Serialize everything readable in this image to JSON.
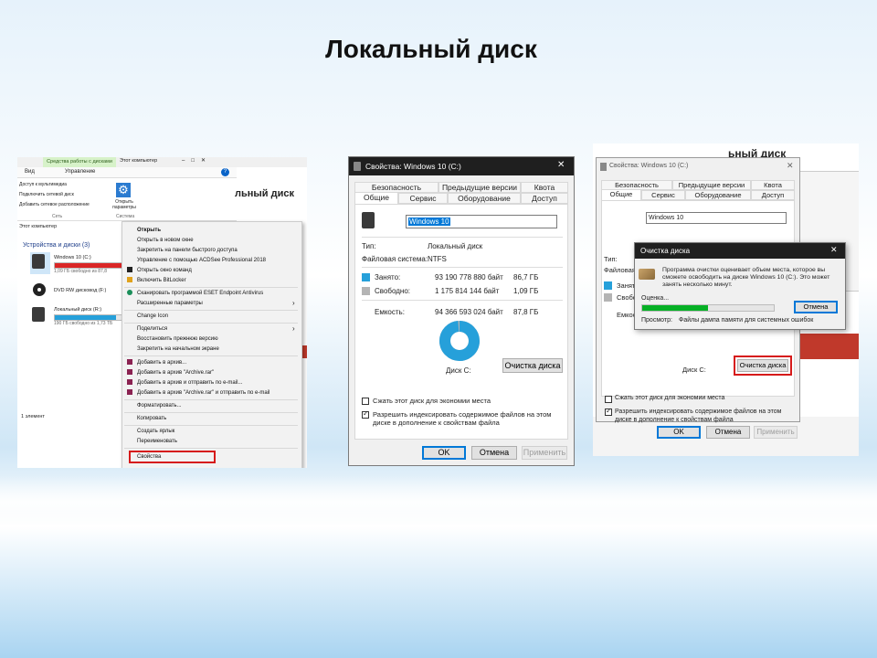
{
  "slide": {
    "title": "Локальный диск"
  },
  "explorer": {
    "ribbon_context": "Средства работы с дисками",
    "ribbon_window": "Этот компьютер",
    "tab_view": "Вид",
    "tab_manage": "Управление",
    "menu_media": "Доступ к мультимедиа",
    "menu_mapdrive": "Подключить сетевой диск",
    "menu_addnet": "Добавить сетевое расположение",
    "group_net": "Сеть",
    "settings_label": "Открыть параметры",
    "group_system": "Система",
    "address": "Этот компьютер",
    "section": "Устройства и диски (3)",
    "drive_c_name": "Windows 10 (C:)",
    "drive_c_free": "1,09 ГБ свободно из 87,8",
    "drive_dvd_name": "DVD RW дисковод (F:)",
    "drive_r_name": "Локальный диск (R:)",
    "drive_r_free": "190 ГБ свободно из 1,73 ТБ",
    "status": "1 элемент",
    "bg_text": "льный диск"
  },
  "context_menu": {
    "items": [
      "Открыть",
      "Открыть в новом окне",
      "Закрепить на панели быстрого доступа",
      "Управление с помощью ACDSee Professional 2018",
      "Открыть окно команд",
      "Включить BitLocker",
      "Сканировать программой ESET Endpoint Antivirus",
      "Расширенные параметры",
      "Change Icon",
      "Поделиться",
      "Восстановить прежнюю версию",
      "Закрепить на начальном экране",
      "Добавить в архив...",
      "Добавить в архив \"Archive.rar\"",
      "Добавить в архив и отправить по e-mail...",
      "Добавить в архив \"Archive.rar\" и отправить по e-mail",
      "Форматировать...",
      "Копировать",
      "Создать ярлык",
      "Переименовать",
      "Свойства"
    ]
  },
  "props": {
    "title": "Свойства: Windows 10 (C:)",
    "tabs_row1": [
      "Безопасность",
      "Предыдущие версии",
      "Квота"
    ],
    "tabs_row2": [
      "Общие",
      "Сервис",
      "Оборудование",
      "Доступ"
    ],
    "volume_name": "Windows 10",
    "type_label": "Тип:",
    "type_value": "Локальный диск",
    "fs_label": "Файловая система:",
    "fs_value": "NTFS",
    "used_label": "Занято:",
    "used_bytes": "93 190 778 880 байт",
    "used_gb": "86,7 ГБ",
    "free_label": "Свободно:",
    "free_bytes": "1 175 814 144 байт",
    "free_gb": "1,09 ГБ",
    "cap_label": "Емкость:",
    "cap_bytes": "94 366 593 024 байт",
    "cap_gb": "87,8 ГБ",
    "disk_label": "Диск C:",
    "cleanup_btn": "Очистка диска",
    "compress": "Сжать этот диск для экономии места",
    "index": "Разрешить индексировать содержимое файлов на этом диске в дополнение к свойствам файла",
    "ok": "OK",
    "cancel": "Отмена",
    "apply": "Применить",
    "used_fraction": 0.987,
    "colors": {
      "used": "#26a0da",
      "free": "#b4b4b4"
    }
  },
  "cleanup": {
    "title": "Очистка диска",
    "message": "Программа очистки оценивает объем места, которое вы сможете освободить на диске Windows 10 (C:). Это может занять несколько минут.",
    "estimate_label": "Оценка...",
    "cancel": "Отмена",
    "view_label": "Просмотр:",
    "view_value": "Файлы дампа памяти для системных ошибок",
    "progress": 0.5
  },
  "bg_header_text": "ьный диск"
}
